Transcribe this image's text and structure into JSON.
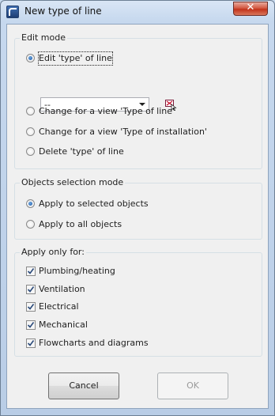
{
  "window": {
    "title": "New type of line"
  },
  "edit_mode": {
    "legend": "Edit mode",
    "options": [
      {
        "label": "Edit 'type' of line",
        "checked": true
      },
      {
        "label": "Change for a view 'Type of line'",
        "checked": false
      },
      {
        "label": "Change for a view 'Type of installation'",
        "checked": false
      },
      {
        "label": "Delete 'type' of line",
        "checked": false
      }
    ],
    "type_select": {
      "value": "--"
    },
    "pick_icon": "select-from-drawing-icon"
  },
  "selection_mode": {
    "legend": "Objects selection mode",
    "options": [
      {
        "label": "Apply to selected objects",
        "checked": true
      },
      {
        "label": "Apply to all objects",
        "checked": false
      }
    ]
  },
  "apply_only_for": {
    "legend": "Apply only for:",
    "items": [
      {
        "label": "Plumbing/heating",
        "checked": true
      },
      {
        "label": "Ventilation",
        "checked": true
      },
      {
        "label": "Electrical",
        "checked": true
      },
      {
        "label": "Mechanical",
        "checked": true
      },
      {
        "label": "Flowcharts and diagrams",
        "checked": true
      }
    ]
  },
  "buttons": {
    "cancel": "Cancel",
    "ok": "OK"
  }
}
